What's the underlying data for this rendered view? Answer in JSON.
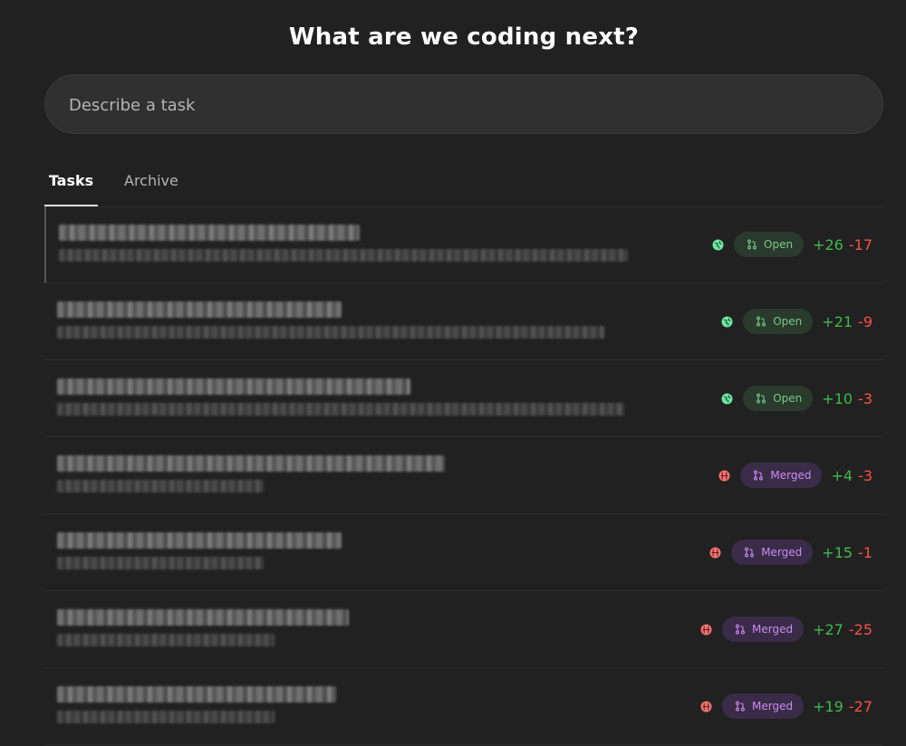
{
  "header": {
    "title": "What are we coding next?"
  },
  "task_input": {
    "placeholder": "Describe a task",
    "value": ""
  },
  "tabs": [
    {
      "label": "Tasks",
      "active": true
    },
    {
      "label": "Archive",
      "active": false
    }
  ],
  "colors": {
    "background": "#212121",
    "open_badge_bg": "#2a3a2c",
    "open_badge_text": "#74c98a",
    "merged_badge_bg": "#3a2c48",
    "merged_badge_text": "#c98cf0",
    "additions": "#3fb950",
    "deletions": "#f85149",
    "status_green": "#6ee7a0",
    "status_red": "#f87171"
  },
  "tasks": [
    {
      "status_icon": "globe-icon-green",
      "pr_state": "Open",
      "additions": "+26",
      "deletions": "-17"
    },
    {
      "status_icon": "globe-icon-green",
      "pr_state": "Open",
      "additions": "+21",
      "deletions": "-9"
    },
    {
      "status_icon": "globe-icon-green",
      "pr_state": "Open",
      "additions": "+10",
      "deletions": "-3"
    },
    {
      "status_icon": "globe-icon-red",
      "pr_state": "Merged",
      "additions": "+4",
      "deletions": "-3"
    },
    {
      "status_icon": "globe-icon-red",
      "pr_state": "Merged",
      "additions": "+15",
      "deletions": "-1"
    },
    {
      "status_icon": "globe-icon-red",
      "pr_state": "Merged",
      "additions": "+27",
      "deletions": "-25"
    },
    {
      "status_icon": "globe-icon-red",
      "pr_state": "Merged",
      "additions": "+19",
      "deletions": "-27"
    }
  ]
}
